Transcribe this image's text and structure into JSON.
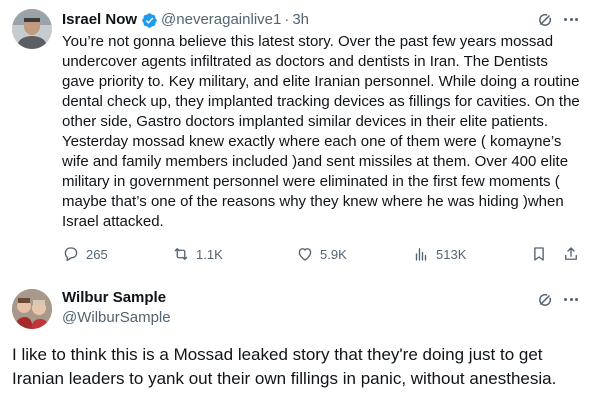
{
  "post": {
    "author_name": "Israel Now",
    "handle": "@neveragainlive1",
    "separator": "·",
    "time": "3h",
    "text": "You’re not gonna believe this latest story. Over the past few years mossad undercover agents infiltrated as doctors and dentists  in Iran. The Dentists gave priority to. Key military, and elite Iranian personnel. While doing a routine dental check up, they implanted tracking devices as fillings for cavities. On the other side, Gastro doctors implanted similar devices in their elite patients. Yesterday mossad knew exactly where each one of them were ( komayne’s wife and family members included )and sent missiles at them. Over 400 elite military in government personnel were eliminated in the first few moments ( maybe that’s one of the reasons why they knew where he was hiding )when Israel attacked.",
    "verified_color": "#1d9bf0",
    "actions": {
      "replies": "265",
      "reposts": "1.1K",
      "likes": "5.9K",
      "views": "513K"
    }
  },
  "reply": {
    "author_name": "Wilbur Sample",
    "handle": "@WilburSample",
    "text": "I like to think this is a Mossad leaked story that they're doing just to get Iranian leaders to yank out their own fillings in panic, without anesthesia."
  },
  "icons": {
    "verified": "verified-badge-icon",
    "grok": "grok-icon",
    "more": "more-icon",
    "reply": "reply-icon",
    "repost": "repost-icon",
    "like": "like-icon",
    "views": "views-icon",
    "bookmark": "bookmark-icon",
    "share": "share-icon"
  }
}
